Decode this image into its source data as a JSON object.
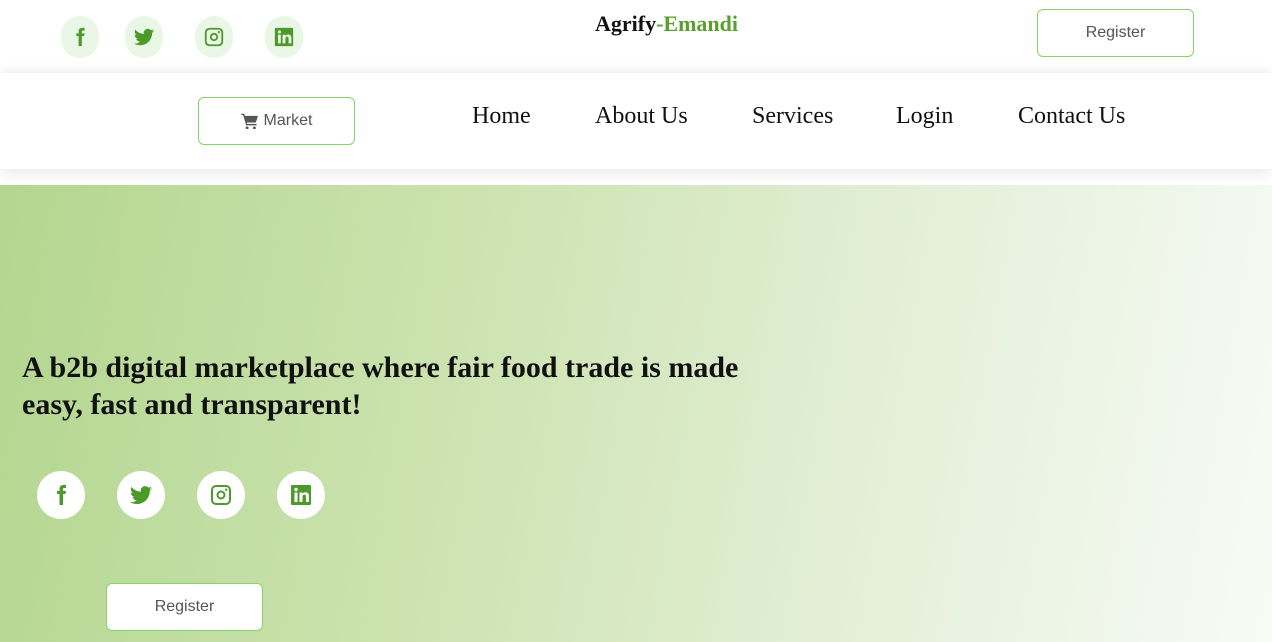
{
  "top_bar": {
    "social_icons": [
      "facebook-icon",
      "twitter-icon",
      "instagram-icon",
      "linkedin-icon"
    ],
    "brand": {
      "part1": "Agrify",
      "separator": "-",
      "part2": "Emandi"
    },
    "register_label": "Register"
  },
  "nav": {
    "market_label": "Market",
    "market_icon": "shopping-cart-icon",
    "links": [
      "Home",
      "About Us",
      "Services",
      "Login",
      "Contact Us"
    ]
  },
  "hero": {
    "title": "A b2b digital marketplace where fair food trade is made easy, fast and transparent!",
    "social_icons": [
      "facebook-icon",
      "twitter-icon",
      "instagram-icon",
      "linkedin-icon"
    ],
    "register_label": "Register"
  },
  "colors": {
    "accent_green": "#5aa02c",
    "icon_green": "#4c9a2a",
    "button_border": "#86d46a",
    "hero_gradient_start": "#b3d68f",
    "hero_gradient_end": "#f8fbf5"
  }
}
